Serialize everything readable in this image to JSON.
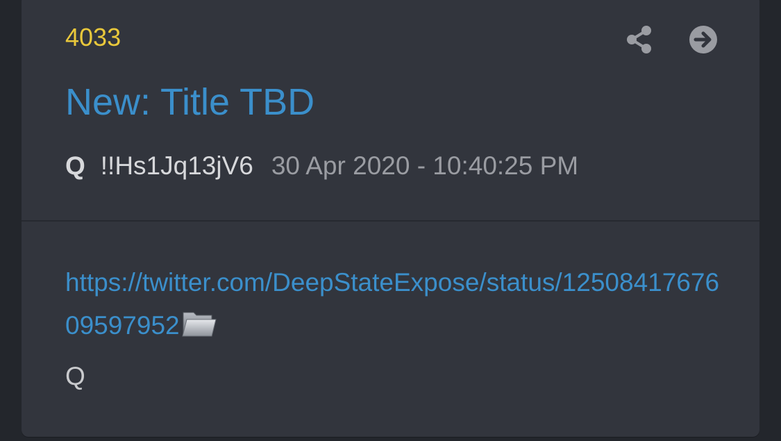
{
  "post": {
    "number": "4033",
    "title": "New: Title TBD",
    "author": "Q",
    "tripcode": "!!Hs1Jq13jV6",
    "timestamp": "30 Apr 2020 - 10:40:25 PM",
    "link_text": "https://twitter.com/DeepStateExpose/status/1250841767609597952",
    "signature": "Q"
  },
  "icons": {
    "share": "share-icon",
    "open": "arrow-right-circle-icon",
    "folder": "folder-icon"
  },
  "colors": {
    "background": "#23262c",
    "card": "#32353d",
    "post_number": "#e9c83b",
    "accent": "#3b8fcb",
    "text": "#d7d8db",
    "muted": "#9a9ca2"
  }
}
